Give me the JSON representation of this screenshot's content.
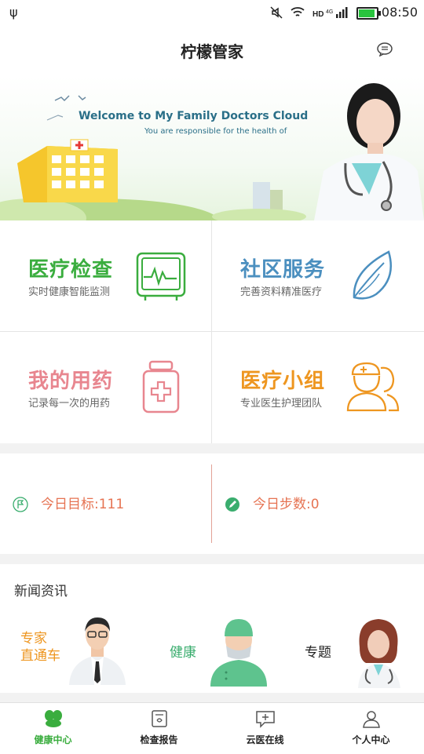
{
  "status": {
    "time": "08:50"
  },
  "app_title": "柠檬管家",
  "banner": {
    "welcome": "Welcome to My Family Doctors Cloud",
    "subtitle": "You are responsible for the health of"
  },
  "tiles": [
    {
      "title": "医疗检查",
      "desc": "实时健康智能监测",
      "color": "#3aad3e",
      "icon": "monitor-icon"
    },
    {
      "title": "社区服务",
      "desc": "完善资料精准医疗",
      "color": "#4b8fbf",
      "icon": "leaf-icon"
    },
    {
      "title": "我的用药",
      "desc": "记录每一次的用药",
      "color": "#e8868f",
      "icon": "medicine-bottle-icon"
    },
    {
      "title": "医疗小组",
      "desc": "专业医生护理团队",
      "color": "#ee9620",
      "icon": "medical-team-icon"
    }
  ],
  "goals": {
    "target": "今日目标:111",
    "steps": "今日步数:0"
  },
  "news": {
    "title": "新闻资讯",
    "items": [
      {
        "label_line1": "专家",
        "label_line2": "直通车",
        "color": "#ee9620"
      },
      {
        "label_line1": "健康",
        "label_line2": "",
        "color": "#3aad6e"
      },
      {
        "label_line1": "专题",
        "label_line2": "",
        "color": "#222222"
      }
    ]
  },
  "tabs": [
    {
      "label": "健康中心",
      "active": true,
      "color": "#3aad3e"
    },
    {
      "label": "检查报告",
      "active": false,
      "color": "#222222"
    },
    {
      "label": "云医在线",
      "active": false,
      "color": "#222222"
    },
    {
      "label": "个人中心",
      "active": false,
      "color": "#222222"
    }
  ]
}
